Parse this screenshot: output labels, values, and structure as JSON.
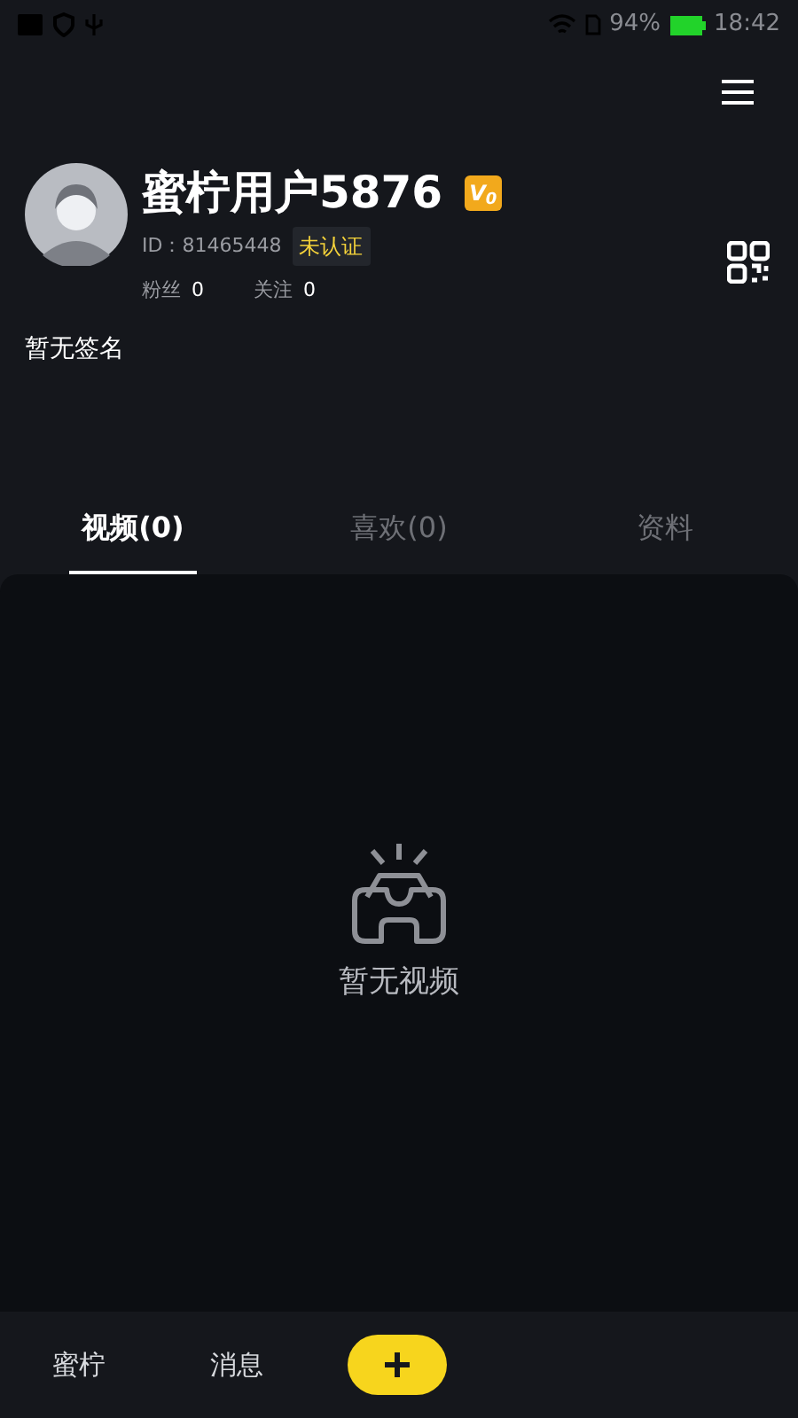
{
  "status_bar": {
    "battery": "94%",
    "time": "18:42"
  },
  "profile": {
    "name": "蜜柠用户5876",
    "vip_badge": "V$_{0}$",
    "id": "ID：81465448",
    "verification": "未认证",
    "stats": [
      {
        "label": "粉丝",
        "value": "0"
      },
      {
        "label": "关注",
        "value": "0"
      }
    ],
    "signature": "暂无签名"
  },
  "tabs": [
    {
      "label": "视频(0)",
      "selected": true
    },
    {
      "label": "喜欢(0)",
      "selected": false
    },
    {
      "label": "资料",
      "selected": false
    }
  ],
  "empty_state": {
    "text": "暂无视频"
  },
  "bottom_nav": [
    {
      "kind": "tab",
      "label": "蜜柠"
    },
    {
      "kind": "tab",
      "label": "消息"
    },
    {
      "kind": "create"
    }
  ]
}
